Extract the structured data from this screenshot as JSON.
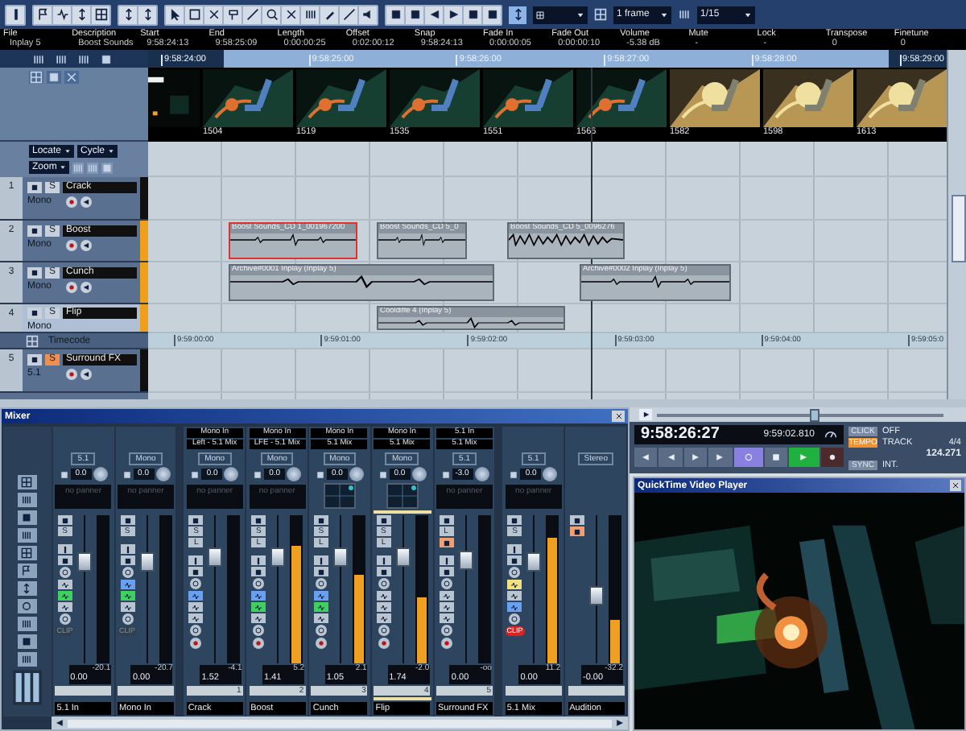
{
  "toolbar": {
    "snap_type": "1 frame",
    "grid": "1/15"
  },
  "info_line": [
    {
      "label": "File",
      "value": "Inplay 5"
    },
    {
      "label": "Description",
      "value": "Boost Sounds"
    },
    {
      "label": "Start",
      "value": "9:58:24:13"
    },
    {
      "label": "End",
      "value": "9:58:25:09"
    },
    {
      "label": "Length",
      "value": "0:00:00:25"
    },
    {
      "label": "Offset",
      "value": "0:02:00:12"
    },
    {
      "label": "Snap",
      "value": "9:58:24:13"
    },
    {
      "label": "Fade In",
      "value": "0:00:00:05"
    },
    {
      "label": "Fade Out",
      "value": "0:00:00:10"
    },
    {
      "label": "Volume",
      "value": "-5.38 dB"
    },
    {
      "label": "Mute",
      "value": "-"
    },
    {
      "label": "Lock",
      "value": "-"
    },
    {
      "label": "Transpose",
      "value": "0"
    },
    {
      "label": "Finetune",
      "value": "0"
    }
  ],
  "ruler": [
    "9:58:24:00",
    "9:58:25:00",
    "9:58:26:00",
    "9:58:27:00",
    "9:58:28:00",
    "9:58:29:00"
  ],
  "video_track": {
    "frames": [
      "1504",
      "1519",
      "1535",
      "1551",
      "1566",
      "1582",
      "1598",
      "1613"
    ]
  },
  "track_controls": {
    "locate": "Locate",
    "cycle": "Cycle",
    "zoom": "Zoom"
  },
  "tracks": [
    {
      "kind": "audio",
      "number": "1",
      "name": "Crack",
      "format": "Mono",
      "solo_label": "S",
      "solo": false,
      "selected": false,
      "color": "#101010"
    },
    {
      "kind": "audio",
      "number": "2",
      "name": "Boost",
      "format": "Mono",
      "solo_label": "S",
      "solo": false,
      "selected": false,
      "color": "#f0a018",
      "events": [
        {
          "label": "Boost Sounds_CD 1_001967200",
          "selected": true
        },
        {
          "label": "Boost Sounds_CD 5_0",
          "selected": false
        },
        {
          "label": "Boost Sounds_CD 5_0096276",
          "selected": false
        }
      ]
    },
    {
      "kind": "audio",
      "number": "3",
      "name": "Cunch",
      "format": "Mono",
      "solo_label": "S",
      "solo": false,
      "selected": false,
      "color": "#f0a018",
      "events": [
        {
          "label": "Archive#0001 Inplay (Inplay 5)",
          "selected": false
        },
        {
          "label": "Archive#0002 Inplay (Inplay 5)",
          "selected": false
        }
      ]
    },
    {
      "kind": "audio",
      "number": "4",
      "name": "Flip",
      "format": "Mono",
      "solo_label": "S",
      "solo": false,
      "selected": true,
      "color": "#f0a018",
      "events": [
        {
          "label": "Cooldiffe 4 (Inplay 5)",
          "selected": false
        }
      ]
    },
    {
      "kind": "timecode",
      "name": "Timecode",
      "ticks": [
        "9:59:00:00",
        "9:59:01:00",
        "9:59:02:00",
        "9:59:03:00",
        "9:59:04:00",
        "9:59:05:0"
      ]
    },
    {
      "kind": "audio",
      "number": "5",
      "name": "Surround FX",
      "format": "5.1",
      "solo_label": "S",
      "solo": true,
      "selected": false,
      "color": "#101010"
    }
  ],
  "mixer": {
    "title": "Mixer",
    "channels": [
      {
        "kind": "input",
        "name": "5.1 In",
        "format": "5.1",
        "gain": "0.0",
        "panner": "no panner",
        "buttons": [
          "S"
        ],
        "toggles": [
          false,
          true,
          false
        ],
        "fader": {
          "level": 0.72
        },
        "value": "0.00",
        "peak": "-20.1",
        "clip": {
          "label": "CLIP",
          "on": false
        },
        "selected": false
      },
      {
        "kind": "input",
        "name": "Mono In",
        "format": "Mono",
        "gain": "0.0",
        "panner": "no panner",
        "buttons": [
          "S"
        ],
        "toggles": [
          true,
          true,
          false
        ],
        "fader": {
          "level": 0.72
        },
        "value": "0.00",
        "peak": "-20.7",
        "clip": {
          "label": "CLIP",
          "on": false
        },
        "selected": false
      },
      {
        "kind": "track",
        "name": "Crack",
        "input": "Mono In",
        "output": "Left - 5.1 Mix",
        "format": "Mono",
        "gain": "0.0",
        "panner": "no panner",
        "buttons": [
          "S",
          "L"
        ],
        "toggles": [
          true,
          false,
          false
        ],
        "fader": {
          "level": 0.75
        },
        "value": "1.52",
        "peak": "-4.1",
        "number": "1",
        "selected": false
      },
      {
        "kind": "track",
        "name": "Boost",
        "input": "Mono In",
        "output": "LFE - 5.1 Mix",
        "format": "Mono",
        "gain": "0.0",
        "panner": "no panner",
        "buttons": [
          "S",
          "L"
        ],
        "toggles": [
          true,
          true,
          false
        ],
        "fader": {
          "level": 0.75
        },
        "meter": {
          "level": 0.8
        },
        "value": "1.41",
        "peak": "5.2",
        "number": "2",
        "selected": false
      },
      {
        "kind": "track",
        "name": "Cunch",
        "input": "Mono In",
        "output": "5.1 Mix",
        "format": "Mono",
        "gain": "0.0",
        "buttons": [
          "S",
          "L"
        ],
        "toggles": [
          true,
          true,
          false
        ],
        "fader": {
          "level": 0.76
        },
        "meter": {
          "level": 0.6
        },
        "value": "1.05",
        "peak": "2.1",
        "number": "3",
        "selected": false
      },
      {
        "kind": "track",
        "name": "Flip",
        "input": "Mono In",
        "output": "5.1 Mix",
        "format": "Mono",
        "gain": "0.0",
        "buttons": [
          "S",
          "L"
        ],
        "toggles": [
          false,
          false,
          false
        ],
        "fader": {
          "level": 0.75
        },
        "meter": {
          "level": 0.45
        },
        "value": "1.74",
        "peak": "-2.0",
        "number": "4",
        "selected": true
      },
      {
        "kind": "track",
        "name": "Surround FX",
        "input": "5.1 In",
        "output": "5.1 Mix",
        "format": "5.1",
        "gain": "-3.0",
        "panner": "no panner",
        "buttons": [
          "L"
        ],
        "solo": true,
        "toggles": [
          false,
          false,
          false
        ],
        "fader": {
          "level": 0.73
        },
        "value": "0.00",
        "peak": "-oo",
        "number": "5",
        "selected": false
      },
      {
        "kind": "output",
        "name": "5.1 Mix",
        "format": "5.1",
        "gain": "0.0",
        "panner": "no panner",
        "buttons": [
          "S"
        ],
        "toggles": [
          true,
          false,
          true
        ],
        "fader": {
          "level": 0.72
        },
        "meter": {
          "level": 0.85
        },
        "value": "0.00",
        "peak": "11.2",
        "clip": {
          "label": "CLIP",
          "on": true
        },
        "selected": false
      },
      {
        "kind": "monitor",
        "name": "Audition",
        "format": "Stereo",
        "fader": {
          "level": 0.45
        },
        "meter": {
          "level": 0.3
        },
        "value": "-0.00",
        "peak": "-32.2",
        "selected": false
      }
    ]
  },
  "zoom_slider": {
    "level": 0.55
  },
  "transport": {
    "time": "9:58:26:27",
    "secondary_time": "9:59:02.810",
    "cycle_on": true,
    "playing": true,
    "recording": false,
    "click": {
      "label": "CLICK",
      "value": "OFF",
      "on": false
    },
    "tempo": {
      "label": "TEMPO",
      "mode": "TRACK",
      "signature": "4/4",
      "bpm": "124.271",
      "on": true
    },
    "sync": {
      "label": "SYNC",
      "value": "INT.",
      "on": false
    }
  },
  "video_player": {
    "title": "QuickTime Video Player"
  }
}
